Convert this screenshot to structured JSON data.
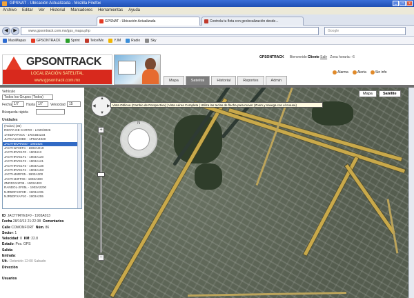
{
  "window": {
    "title": "GPSNAT - Ubicación Actualizada - Mozilla Firefox",
    "min": "_",
    "max": "□",
    "close": "x"
  },
  "menu": [
    "Archivo",
    "Editar",
    "Ver",
    "Historial",
    "Marcadores",
    "Herramientas",
    "Ayuda"
  ],
  "browser_tabs": [
    {
      "label": "GPSNAT - Ubicación Actualizada"
    },
    {
      "label": "Controla tu flota con geolocalización desde..."
    }
  ],
  "address": {
    "url": "www.gpsontrack.com.mx/gps_mapa.php",
    "search_placeholder": "Google"
  },
  "nav": {
    "back": "◀",
    "forward": "▶",
    "reload": "↻",
    "home": "⌂"
  },
  "bookmarks": [
    "MaxiMapas",
    "GPSONTRACK",
    "Sprint",
    "TelcelMx",
    "YJM",
    "Radio",
    "Sky"
  ],
  "bookmark_colors": [
    "#2d6bd1",
    "#e43a24",
    "#2a9f2a",
    "#c0392b",
    "#f0b400",
    "#3a8ed9",
    "#888888"
  ],
  "brand": {
    "name": "GPSONTRACK",
    "tagline": "LOCALIZACIÓN SATELITAL",
    "site": "www.gpsontrack.com.mx",
    "color": "#d8291d"
  },
  "header": {
    "company": "GPSONTRACK",
    "user_prefix": "Bienvenido",
    "user": "Cliente",
    "logout": "Salir",
    "timezone": "Zona horaria: -6"
  },
  "status_legend": [
    "Alarma",
    "Alerta",
    "Sin info"
  ],
  "app_tabs": [
    "Mapa",
    "Satelital",
    "Historial",
    "Reportes",
    "Admin"
  ],
  "app_tab_active": 1,
  "sidebar": {
    "group_label": "Vehículo",
    "group_value": "Todos los Grupos (Todos)",
    "from_label": "Fecha",
    "from_value": "1/7",
    "to_label": "Hasta",
    "to_value": "1/7",
    "speed_label": "Velocidad",
    "speed_value": "15",
    "search_label": "Búsqueda rápida",
    "vehicles_title": "Unidades",
    "vehicles": [
      "(Todos) (36)",
      "RENTA DE CARRO - LO20/3026",
      "1AKDRAF0CK - 1RG4B4234",
      "JUTCA1C20DK - 1P53A4020",
      "JACTHBVRNG0 - 1902424",
      "JACTH1F06TC - 1903AO19",
      "JACTHRYE1F0 - 1903413",
      "JACTHRYE1F1 - 1903A120",
      "JACTHRYE1F2 - 1903A121",
      "JACTHRYE1F3 - 1903A138",
      "JACTHRYE1F4 - 1903A193",
      "JACTH46RF05 - 1903A300",
      "JACTH43FF06 - 1903A300",
      "ZNRDXX1F05 - 1903A303",
      "RANDOL-2F05L - 1903A2200",
      "NJR5DFX2F0D - 1903A235",
      "NJR5DFXAP10 - 1903A255"
    ],
    "selected_vehicle": 4
  },
  "info": {
    "id_label": "ID",
    "id_value": "JACTHRYE1F0 - 1903A013",
    "date_label": "Fecha",
    "date_value": "28/10/13 21:22:38",
    "direction_label": "Dirección",
    "street_label": "Calle",
    "street_value": "COMONFORT",
    "num_label": "Núm.",
    "num_value": "86",
    "sector_label": "Sector",
    "sector_value": "1",
    "speed_label": "Velocidad",
    "speed_value": "0",
    "kms_label": "KM",
    "kms_value": "22.8",
    "state_label": "Estado",
    "state_value": "Pos. GPS",
    "extra1_label": "Salida",
    "extra2_label": "Entrada",
    "address_label": "Ult.",
    "address_value": "Detenido 12:00 Sabado",
    "comments_label": "Comentarios",
    "footer_label": "Usuarios"
  },
  "map": {
    "mode_map": "Mapa",
    "mode_sat": "Satélite",
    "tooltip": "Vista Oblicua (Cambio de Perspectiva) | Vista Aérea Completa | Utiliza las teclas de flecha para mover (Zoom y navega con el mouse)",
    "zoom_in": "+",
    "zoom_out": "−",
    "zoom_level": 0.33,
    "compass_n": "N",
    "colors": {
      "road": "#c9a94a",
      "urban": "#5d6656",
      "park": "#2f3d2a"
    }
  }
}
